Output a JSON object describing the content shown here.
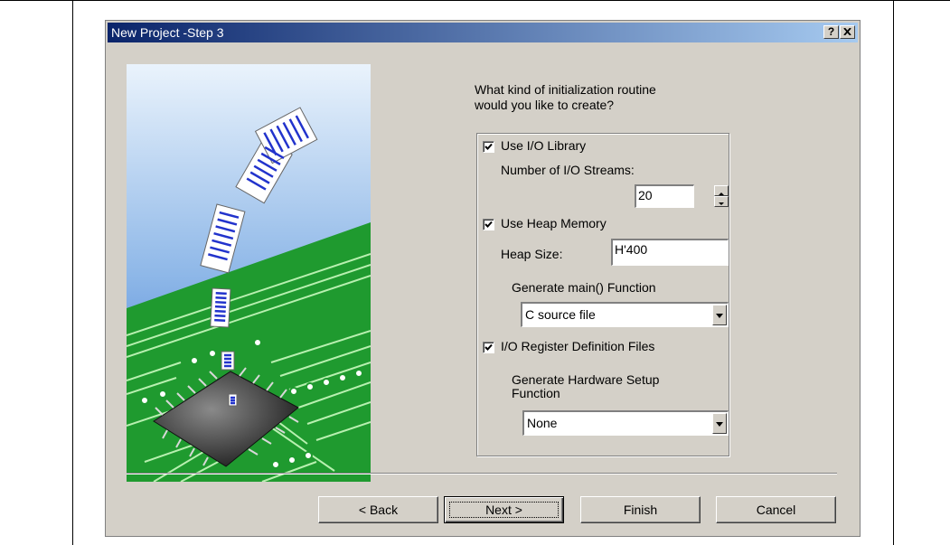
{
  "dialog": {
    "title": "New Project -Step 3",
    "help_button": "?",
    "close_button": "✕"
  },
  "prompt": "What kind of initialization routine\nwould you like to create?",
  "options": {
    "use_io_library": {
      "label": "Use I/O Library",
      "checked": true
    },
    "io_streams": {
      "label": "Number of I/O Streams:",
      "value": "20"
    },
    "use_heap_memory": {
      "label": "Use Heap Memory",
      "checked": true
    },
    "heap_size": {
      "label": "Heap Size:",
      "value": "H'400"
    },
    "main_function": {
      "label": "Generate main() Function",
      "selected": "C source file"
    },
    "io_register_files": {
      "label": "I/O Register Definition Files",
      "checked": true
    },
    "hardware_setup": {
      "label": "Generate Hardware Setup\nFunction",
      "selected": "None"
    }
  },
  "buttons": {
    "back": "< Back",
    "next": "Next >",
    "finish": "Finish",
    "cancel": "Cancel"
  },
  "colors": {
    "title_start": "#0a246a",
    "title_end": "#a6caf0",
    "dialog_face": "#d4d0c8",
    "pcb_green": "#1f9a2f"
  }
}
